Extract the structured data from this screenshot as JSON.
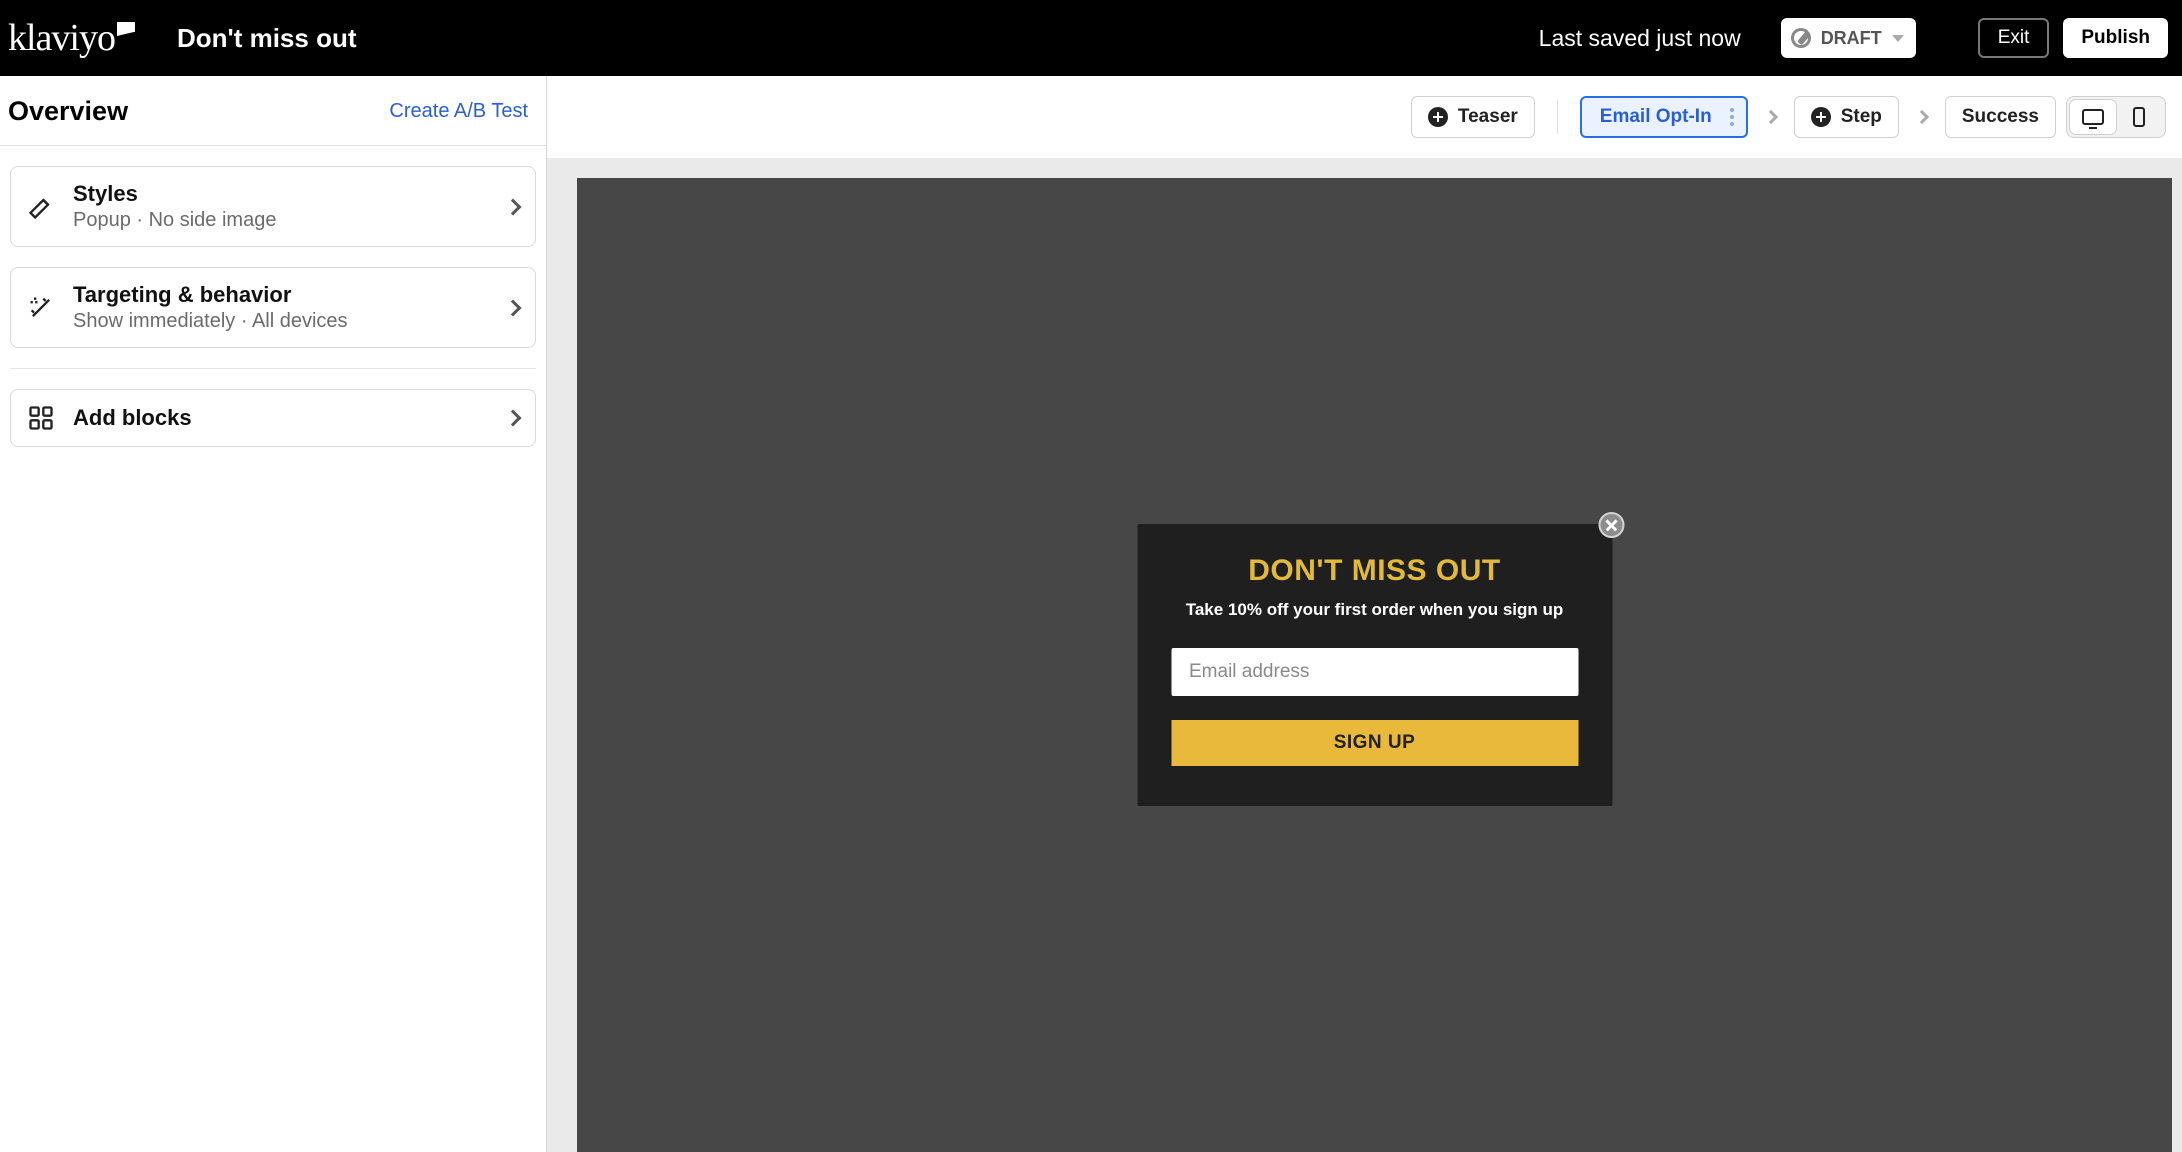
{
  "header": {
    "brand": "klaviyo",
    "form_name": "Don't miss out",
    "last_saved": "Last saved just now",
    "status_label": "DRAFT",
    "exit_label": "Exit",
    "publish_label": "Publish"
  },
  "sidebar": {
    "title": "Overview",
    "ab_link": "Create A/B Test",
    "cards": [
      {
        "title": "Styles",
        "subtitle": "Popup · No side image"
      },
      {
        "title": "Targeting & behavior",
        "subtitle": "Show immediately · All devices"
      },
      {
        "title": "Add blocks",
        "subtitle": ""
      }
    ]
  },
  "steps": {
    "teaser": "Teaser",
    "active": "Email Opt-In",
    "step": "Step",
    "success": "Success"
  },
  "popup": {
    "title": "DON'T MISS OUT",
    "subtitle": "Take 10% off your first order when you sign up",
    "email_placeholder": "Email address",
    "button_label": "SIGN UP"
  }
}
